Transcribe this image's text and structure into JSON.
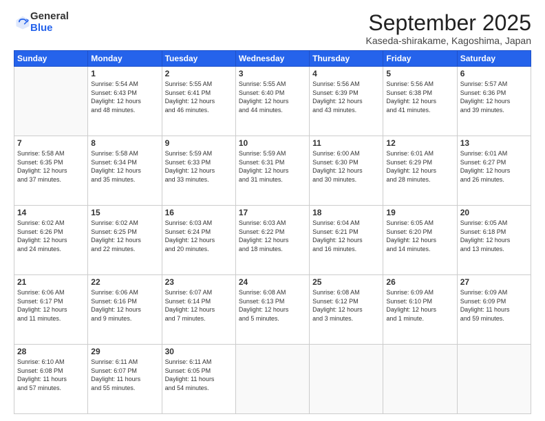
{
  "logo": {
    "general": "General",
    "blue": "Blue"
  },
  "header": {
    "month": "September 2025",
    "location": "Kaseda-shirakame, Kagoshima, Japan"
  },
  "weekdays": [
    "Sunday",
    "Monday",
    "Tuesday",
    "Wednesday",
    "Thursday",
    "Friday",
    "Saturday"
  ],
  "weeks": [
    [
      {
        "day": "",
        "info": ""
      },
      {
        "day": "1",
        "info": "Sunrise: 5:54 AM\nSunset: 6:43 PM\nDaylight: 12 hours\nand 48 minutes."
      },
      {
        "day": "2",
        "info": "Sunrise: 5:55 AM\nSunset: 6:41 PM\nDaylight: 12 hours\nand 46 minutes."
      },
      {
        "day": "3",
        "info": "Sunrise: 5:55 AM\nSunset: 6:40 PM\nDaylight: 12 hours\nand 44 minutes."
      },
      {
        "day": "4",
        "info": "Sunrise: 5:56 AM\nSunset: 6:39 PM\nDaylight: 12 hours\nand 43 minutes."
      },
      {
        "day": "5",
        "info": "Sunrise: 5:56 AM\nSunset: 6:38 PM\nDaylight: 12 hours\nand 41 minutes."
      },
      {
        "day": "6",
        "info": "Sunrise: 5:57 AM\nSunset: 6:36 PM\nDaylight: 12 hours\nand 39 minutes."
      }
    ],
    [
      {
        "day": "7",
        "info": "Sunrise: 5:58 AM\nSunset: 6:35 PM\nDaylight: 12 hours\nand 37 minutes."
      },
      {
        "day": "8",
        "info": "Sunrise: 5:58 AM\nSunset: 6:34 PM\nDaylight: 12 hours\nand 35 minutes."
      },
      {
        "day": "9",
        "info": "Sunrise: 5:59 AM\nSunset: 6:33 PM\nDaylight: 12 hours\nand 33 minutes."
      },
      {
        "day": "10",
        "info": "Sunrise: 5:59 AM\nSunset: 6:31 PM\nDaylight: 12 hours\nand 31 minutes."
      },
      {
        "day": "11",
        "info": "Sunrise: 6:00 AM\nSunset: 6:30 PM\nDaylight: 12 hours\nand 30 minutes."
      },
      {
        "day": "12",
        "info": "Sunrise: 6:01 AM\nSunset: 6:29 PM\nDaylight: 12 hours\nand 28 minutes."
      },
      {
        "day": "13",
        "info": "Sunrise: 6:01 AM\nSunset: 6:27 PM\nDaylight: 12 hours\nand 26 minutes."
      }
    ],
    [
      {
        "day": "14",
        "info": "Sunrise: 6:02 AM\nSunset: 6:26 PM\nDaylight: 12 hours\nand 24 minutes."
      },
      {
        "day": "15",
        "info": "Sunrise: 6:02 AM\nSunset: 6:25 PM\nDaylight: 12 hours\nand 22 minutes."
      },
      {
        "day": "16",
        "info": "Sunrise: 6:03 AM\nSunset: 6:24 PM\nDaylight: 12 hours\nand 20 minutes."
      },
      {
        "day": "17",
        "info": "Sunrise: 6:03 AM\nSunset: 6:22 PM\nDaylight: 12 hours\nand 18 minutes."
      },
      {
        "day": "18",
        "info": "Sunrise: 6:04 AM\nSunset: 6:21 PM\nDaylight: 12 hours\nand 16 minutes."
      },
      {
        "day": "19",
        "info": "Sunrise: 6:05 AM\nSunset: 6:20 PM\nDaylight: 12 hours\nand 14 minutes."
      },
      {
        "day": "20",
        "info": "Sunrise: 6:05 AM\nSunset: 6:18 PM\nDaylight: 12 hours\nand 13 minutes."
      }
    ],
    [
      {
        "day": "21",
        "info": "Sunrise: 6:06 AM\nSunset: 6:17 PM\nDaylight: 12 hours\nand 11 minutes."
      },
      {
        "day": "22",
        "info": "Sunrise: 6:06 AM\nSunset: 6:16 PM\nDaylight: 12 hours\nand 9 minutes."
      },
      {
        "day": "23",
        "info": "Sunrise: 6:07 AM\nSunset: 6:14 PM\nDaylight: 12 hours\nand 7 minutes."
      },
      {
        "day": "24",
        "info": "Sunrise: 6:08 AM\nSunset: 6:13 PM\nDaylight: 12 hours\nand 5 minutes."
      },
      {
        "day": "25",
        "info": "Sunrise: 6:08 AM\nSunset: 6:12 PM\nDaylight: 12 hours\nand 3 minutes."
      },
      {
        "day": "26",
        "info": "Sunrise: 6:09 AM\nSunset: 6:10 PM\nDaylight: 12 hours\nand 1 minute."
      },
      {
        "day": "27",
        "info": "Sunrise: 6:09 AM\nSunset: 6:09 PM\nDaylight: 11 hours\nand 59 minutes."
      }
    ],
    [
      {
        "day": "28",
        "info": "Sunrise: 6:10 AM\nSunset: 6:08 PM\nDaylight: 11 hours\nand 57 minutes."
      },
      {
        "day": "29",
        "info": "Sunrise: 6:11 AM\nSunset: 6:07 PM\nDaylight: 11 hours\nand 55 minutes."
      },
      {
        "day": "30",
        "info": "Sunrise: 6:11 AM\nSunset: 6:05 PM\nDaylight: 11 hours\nand 54 minutes."
      },
      {
        "day": "",
        "info": ""
      },
      {
        "day": "",
        "info": ""
      },
      {
        "day": "",
        "info": ""
      },
      {
        "day": "",
        "info": ""
      }
    ]
  ]
}
